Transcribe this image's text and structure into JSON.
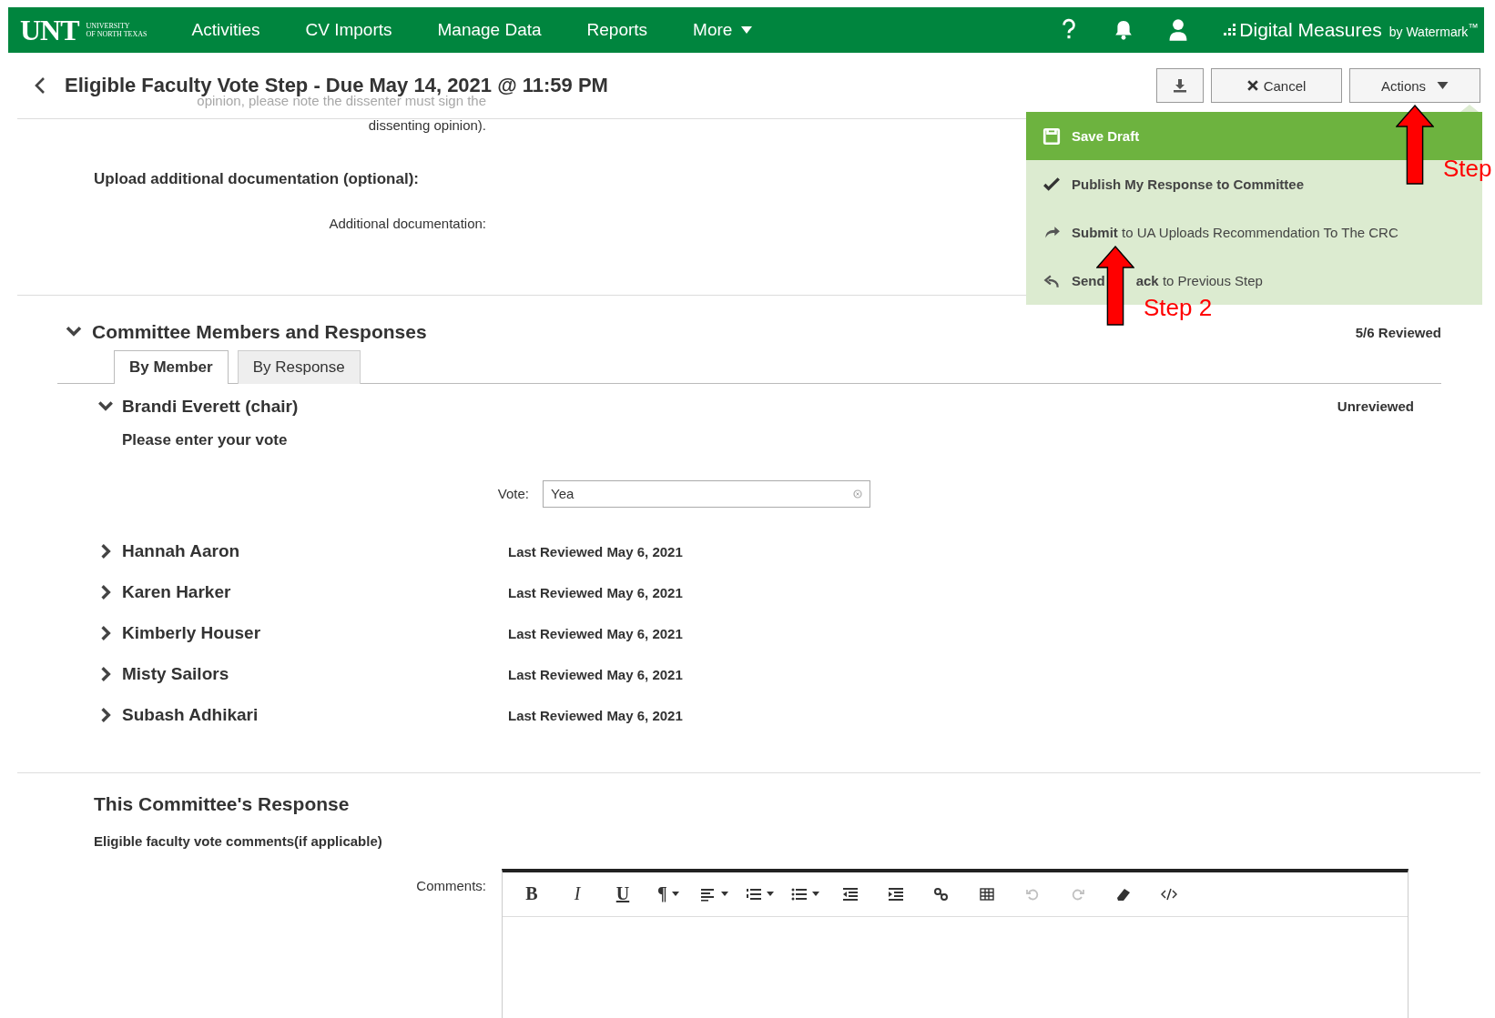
{
  "top_nav": {
    "logo": "UNT",
    "logo_sub": [
      "UNIVERSITY",
      "OF NORTH TEXAS"
    ],
    "items": [
      {
        "label": "Activities",
        "has_menu": false
      },
      {
        "label": "CV Imports",
        "has_menu": false
      },
      {
        "label": "Manage Data",
        "has_menu": false
      },
      {
        "label": "Reports",
        "has_menu": false
      },
      {
        "label": "More",
        "has_menu": true
      }
    ],
    "brand": "Digital Measures",
    "brand_by": "by Watermark$^{™}$"
  },
  "page_header": {
    "title": "Eligible Faculty Vote Step - Due May 14, 2021 @ 11:59 PM",
    "behind_text": "opinion, please note the dissenter must sign the",
    "buttons": [
      {
        "kind": "download"
      },
      {
        "kind": "cancel",
        "label": "Cancel"
      },
      {
        "kind": "menu",
        "label": "Actions"
      }
    ]
  },
  "scrolled_text": "dissenting opinion).",
  "upload_section": {
    "heading": "Upload additional documentation (optional):",
    "field_label": "Additional documentation:"
  },
  "actions_menu": {
    "items": [
      {
        "kind": "save",
        "label": "Save Draft",
        "highlighted": true
      },
      {
        "kind": "check",
        "label": "**Publish My Response to Committee**",
        "highlighted": false
      },
      {
        "kind": "forward",
        "label": "**Submit** to UA Uploads Recommendation To The CRC",
        "highlighted": false
      },
      {
        "kind": "back",
        "label": "**Send**",
        "label_rest": "**ack** to Previous Step",
        "highlighted": false
      }
    ]
  },
  "annotations": [
    {
      "kind": "step1",
      "label": "Step"
    },
    {
      "kind": "step2",
      "label": "Step 2"
    }
  ],
  "committee": {
    "title": "Committee Members and Responses",
    "expanded": true,
    "summary": "5/6 Reviewed",
    "tabs": [
      {
        "label": "By Member",
        "selected": true
      },
      {
        "label": "By Response",
        "selected": false
      }
    ],
    "members": [
      {
        "name": "Brandi Everett (chair)",
        "expanded": true,
        "status": "Unreviewed",
        "prompt": "Please enter your vote",
        "vote_label": "Vote:",
        "vote_value": "Yea"
      },
      {
        "name": "Hannah Aaron",
        "expanded": false,
        "status": "Last Reviewed May 6, 2021"
      },
      {
        "name": "Karen Harker",
        "expanded": false,
        "status": "Last Reviewed May 6, 2021"
      },
      {
        "name": "Kimberly Houser",
        "expanded": false,
        "status": "Last Reviewed May 6, 2021"
      },
      {
        "name": "Misty Sailors",
        "expanded": false,
        "status": "Last Reviewed May 6, 2021"
      },
      {
        "name": "Subash Adhikari",
        "expanded": false,
        "status": "Last Reviewed May 6, 2021"
      }
    ]
  },
  "response": {
    "title": "This Committee's Response",
    "subtitle": "Eligible faculty vote comments(if applicable)",
    "comments_label": "Comments:",
    "toolbar": [
      {
        "kind": "bold",
        "label": "B",
        "disabled": false
      },
      {
        "kind": "italic",
        "label": "I",
        "disabled": false
      },
      {
        "kind": "underline",
        "label": "U",
        "disabled": false
      },
      {
        "kind": "paragraph",
        "label": "¶",
        "disabled": false
      },
      {
        "kind": "align",
        "disabled": false
      },
      {
        "kind": "ordered-list",
        "disabled": false
      },
      {
        "kind": "bullet-list",
        "disabled": false
      },
      {
        "kind": "outdent",
        "disabled": false
      },
      {
        "kind": "indent",
        "disabled": false
      },
      {
        "kind": "link",
        "disabled": false
      },
      {
        "kind": "table",
        "disabled": false
      },
      {
        "kind": "undo",
        "disabled": true
      },
      {
        "kind": "redo",
        "disabled": true
      },
      {
        "kind": "eraser",
        "disabled": false
      },
      {
        "kind": "code",
        "disabled": false
      }
    ]
  }
}
